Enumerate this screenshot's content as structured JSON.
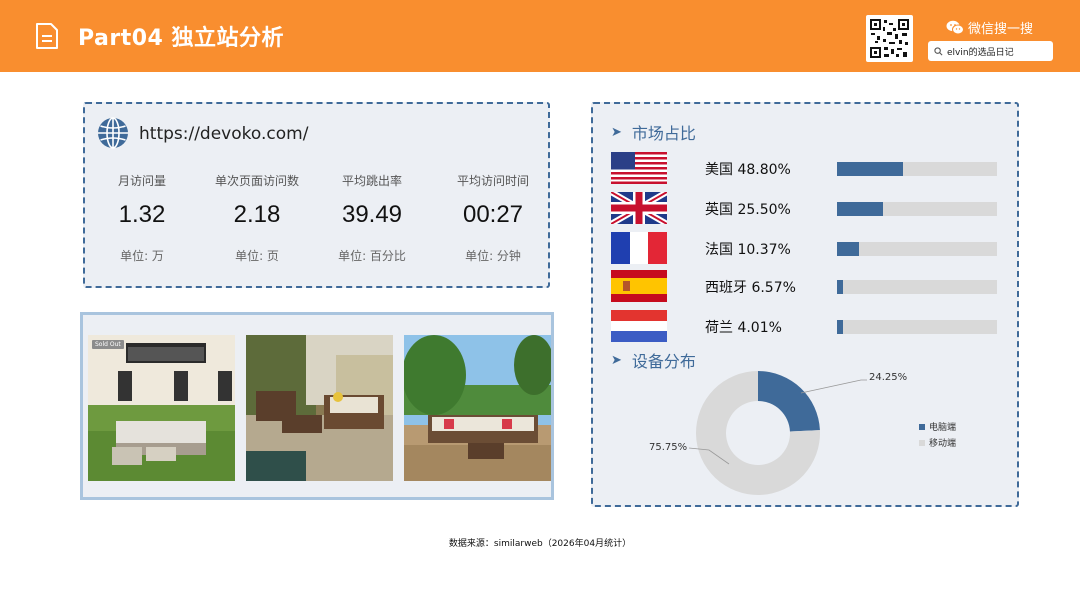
{
  "header": {
    "title": "Part04 独立站分析",
    "wechat_label": "微信搜一搜",
    "search_text": "elvin的选品日记",
    "bg_color": "#f98e2f"
  },
  "site": {
    "url": "https://devoko.com/",
    "stats": [
      {
        "label": "月访问量",
        "value": "1.32",
        "unit": "单位: 万"
      },
      {
        "label": "单次页面访问数",
        "value": "2.18",
        "unit": "单位: 页"
      },
      {
        "label": "平均跳出率",
        "value": "39.49",
        "unit": "单位: 百分比"
      },
      {
        "label": "平均访问时间",
        "value": "00:27",
        "unit": "单位: 分钟"
      }
    ]
  },
  "photos": {
    "sold_out_badge": "Sold Out"
  },
  "market": {
    "title": "市场占比",
    "rows": [
      {
        "country": "美国 48.80%",
        "flag": "us-flag",
        "share": 0.4146
      },
      {
        "country": "英国 25.50%",
        "flag": "uk-flag",
        "share": 0.2875
      },
      {
        "country": "法国 10.37%",
        "flag": "france-flag",
        "share": 0.1375
      },
      {
        "country": "西班牙 6.57%",
        "flag": "spain-flag",
        "share": 0.04
      },
      {
        "country": "荷兰 4.01%",
        "flag": "netherlands-flag",
        "share": 0.04
      }
    ]
  },
  "device": {
    "title": "设备分布",
    "desktop_pct": "24.25%",
    "mobile_pct": "75.75%",
    "legend": [
      "电脑端",
      "移动端"
    ],
    "colors": {
      "desktop": "#3f6a99",
      "mobile": "#d9d9d9"
    }
  },
  "chart_data": {
    "type": "pie",
    "categories": [
      "电脑端",
      "移动端"
    ],
    "values": [
      24.25,
      75.75
    ]
  },
  "footer": {
    "source": "数据来源：similarweb（2026年04月统计）"
  }
}
